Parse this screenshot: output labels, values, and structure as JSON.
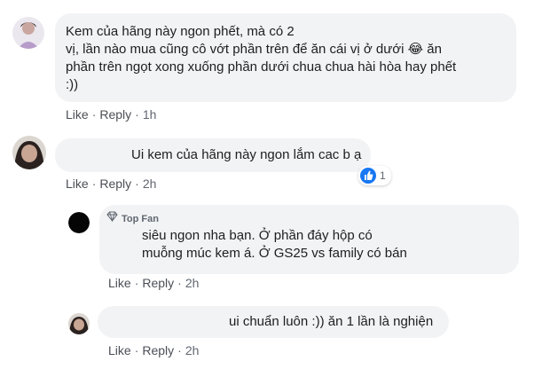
{
  "actions": {
    "like": "Like",
    "reply": "Reply",
    "separator": "·"
  },
  "comments": [
    {
      "text": "Kem của hãng này ngon phết, mà có 2\nvị, lần nào mua cũng cô vớt phần trên để ăn cái vị ở dưới 😂 ăn\nphần trên ngọt xong xuống phần dưới chua chua hài hòa hay phết\n:))",
      "time": "1h"
    },
    {
      "text": "Ui kem của hãng này ngon lắm cac b ạ",
      "time": "2h",
      "reaction_count": "1"
    }
  ],
  "replies": [
    {
      "badge": "Top Fan",
      "text": "siêu ngon nha bạn. Ở phần đáy hộp có\nmuỗng múc kem á. Ở GS25 vs family có bán",
      "time": "2h"
    },
    {
      "text": "ui chuẩn luôn :)) ăn 1 lần là nghiện",
      "time": "2h"
    }
  ],
  "colors": {
    "bubble": "#f2f3f5",
    "like_blue": "#1877f2",
    "meta": "#606770"
  }
}
